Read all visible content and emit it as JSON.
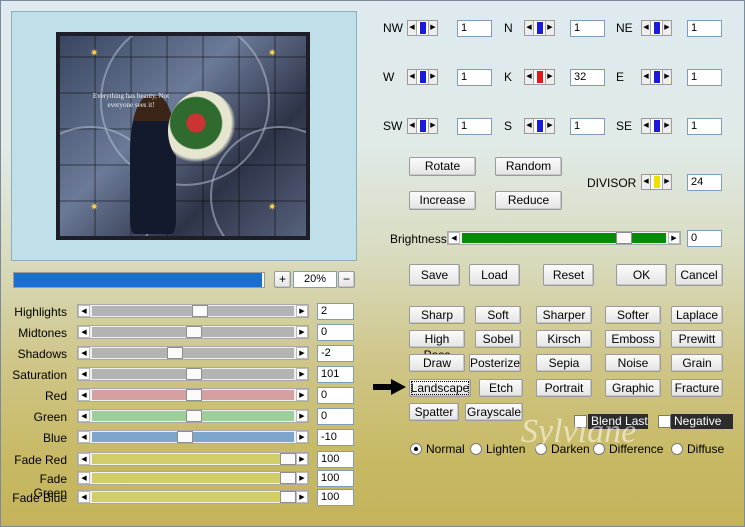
{
  "colors": {
    "progress": "#1a6fcf",
    "brightness": "#0a8a0a",
    "red_track": "#d4a0a0",
    "green_track": "#9cce9c",
    "blue_track": "#7ea6cc",
    "yellow_track": "#d1cd68",
    "grey_track": "#b3b3b3"
  },
  "preview": {
    "artwork_text": "Everything has beauty, Not everyone sees it!",
    "artwork_credit": "Sylviane"
  },
  "progress": {
    "fraction": 0.99
  },
  "zoom": {
    "plus": "+",
    "value": "20%",
    "minus": "−"
  },
  "kernel": [
    {
      "key": "nw",
      "label": "NW",
      "value": "1",
      "marker": "#1a1adc"
    },
    {
      "key": "n",
      "label": "N",
      "value": "1",
      "marker": "#1a1adc"
    },
    {
      "key": "ne",
      "label": "NE",
      "value": "1",
      "marker": "#1a1adc"
    },
    {
      "key": "w",
      "label": "W",
      "value": "1",
      "marker": "#1a1adc"
    },
    {
      "key": "k",
      "label": "K",
      "value": "32",
      "marker": "#e01818"
    },
    {
      "key": "e",
      "label": "E",
      "value": "1",
      "marker": "#1a1adc"
    },
    {
      "key": "sw",
      "label": "SW",
      "value": "1",
      "marker": "#1a1adc"
    },
    {
      "key": "s",
      "label": "S",
      "value": "1",
      "marker": "#1a1adc"
    },
    {
      "key": "se",
      "label": "SE",
      "value": "1",
      "marker": "#1a1adc"
    }
  ],
  "actions": {
    "rotate": "Rotate",
    "random": "Random",
    "increase": "Increase",
    "reduce": "Reduce"
  },
  "divisor": {
    "label": "DIVISOR",
    "value": "24",
    "marker": "#f0e000"
  },
  "brightness": {
    "label": "Brightness",
    "value": "0",
    "level": 0.81
  },
  "buttons": {
    "save": "Save",
    "load": "Load",
    "reset": "Reset",
    "ok": "OK",
    "cancel": "Cancel"
  },
  "presets": [
    "Sharp",
    "Soft",
    "Sharper",
    "Softer",
    "Laplace",
    "High Pass",
    "Sobel",
    "Kirsch",
    "Emboss",
    "Prewitt",
    "Draw",
    "Posterize",
    "Sepia",
    "Noise",
    "Grain",
    "Landscape",
    "Etch",
    "Portrait",
    "Graphic",
    "Fracture",
    "Spatter",
    "Grayscale"
  ],
  "blend_last": "Blend Last",
  "negative": "Negative",
  "modes": [
    "Normal",
    "Lighten",
    "Darken",
    "Difference",
    "Diffuse"
  ],
  "selected_mode": "Normal",
  "watermark": "Sylviane",
  "sliders": [
    {
      "key": "highlights",
      "label": "Highlights",
      "value": "2",
      "level": 0.53,
      "track": "grey"
    },
    {
      "key": "midtones",
      "label": "Midtones",
      "value": "0",
      "level": 0.5,
      "track": "grey"
    },
    {
      "key": "shadows",
      "label": "Shadows",
      "value": "-2",
      "level": 0.4,
      "track": "grey"
    },
    {
      "key": "saturation",
      "label": "Saturation",
      "value": "101",
      "level": 0.5,
      "track": "grey"
    },
    {
      "key": "red",
      "label": "Red",
      "value": "0",
      "level": 0.5,
      "track": "red"
    },
    {
      "key": "green",
      "label": "Green",
      "value": "0",
      "level": 0.5,
      "track": "green"
    },
    {
      "key": "blue",
      "label": "Blue",
      "value": "-10",
      "level": 0.45,
      "track": "blue"
    },
    {
      "key": "fade_red",
      "label": "Fade Red",
      "value": "100",
      "level": 1.0,
      "track": "yellow"
    },
    {
      "key": "fade_green",
      "label": "Fade Green",
      "value": "100",
      "level": 1.0,
      "track": "yellow"
    },
    {
      "key": "fade_blue",
      "label": "Fade Blue",
      "value": "100",
      "level": 1.0,
      "track": "yellow"
    }
  ]
}
